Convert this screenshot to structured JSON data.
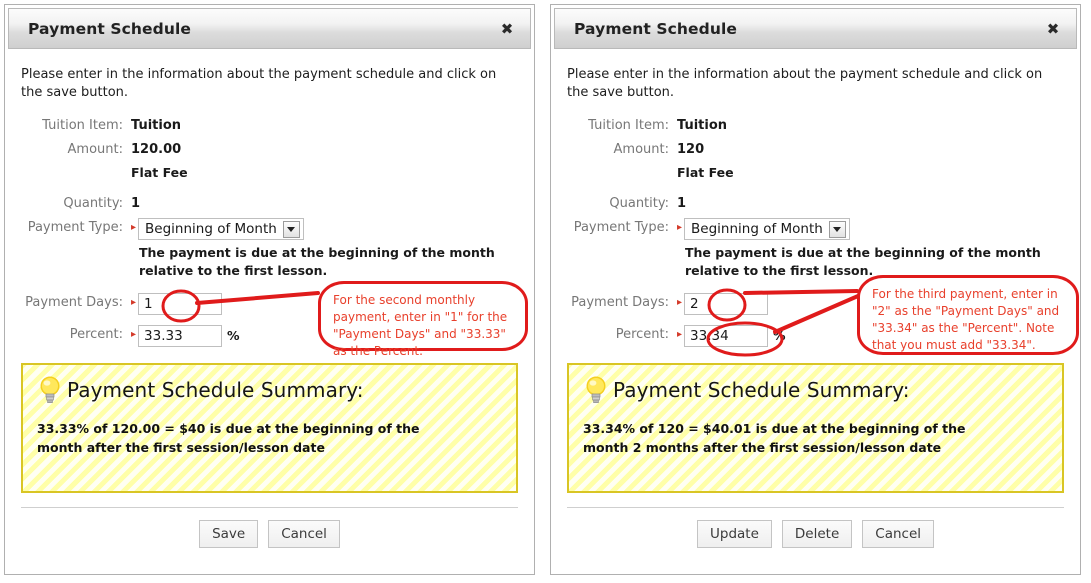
{
  "panels": [
    {
      "title": "Payment Schedule",
      "close_label": "✖",
      "intro": "Please enter in the information about the payment schedule and click on the save button.",
      "fields": {
        "tuition_item_label": "Tuition Item:",
        "tuition_item_value": "Tuition",
        "amount_label": "Amount:",
        "amount_value": "120.00",
        "amount_note": "Flat Fee",
        "quantity_label": "Quantity:",
        "quantity_value": "1",
        "payment_type_label": "Payment Type:",
        "payment_type_value": "Beginning of Month",
        "payment_type_help": "The payment is due at the beginning of the month relative to the first lesson.",
        "payment_days_label": "Payment Days:",
        "payment_days_value": "1",
        "percent_label": "Percent:",
        "percent_value": "33.33",
        "percent_sign": "%",
        "required_marker": "▸"
      },
      "summary": {
        "title": "Payment Schedule Summary:",
        "text": "33.33% of 120.00 = $40 is due at the beginning of the month after the first session/lesson date"
      },
      "buttons": [
        "Save",
        "Cancel"
      ],
      "annotation": "For the second monthly payment, enter in \"1\" for the \"Payment Days\" and \"33.33\" as the Percent."
    },
    {
      "title": "Payment Schedule",
      "close_label": "✖",
      "intro": "Please enter in the information about the payment schedule and click on the save button.",
      "fields": {
        "tuition_item_label": "Tuition Item:",
        "tuition_item_value": "Tuition",
        "amount_label": "Amount:",
        "amount_value": "120",
        "amount_note": "Flat Fee",
        "quantity_label": "Quantity:",
        "quantity_value": "1",
        "payment_type_label": "Payment Type:",
        "payment_type_value": "Beginning of Month",
        "payment_type_help": "The payment is due at the beginning of the month relative to the first lesson.",
        "payment_days_label": "Payment Days:",
        "payment_days_value": "2",
        "percent_label": "Percent:",
        "percent_value": "33.34",
        "percent_sign": "%",
        "required_marker": "▸"
      },
      "summary": {
        "title": "Payment Schedule Summary:",
        "text": "33.34% of 120 = $40.01 is due at the beginning of the month 2 months after the first session/lesson date"
      },
      "buttons": [
        "Update",
        "Delete",
        "Cancel"
      ],
      "annotation": "For the third payment, enter in \"2\" as the \"Payment Days\" and \"33.34\" as the \"Percent\".  Note that you must add \"33.34\"."
    }
  ],
  "colors": {
    "annotation_red": "#e01b1b",
    "annotation_text": "#e8402c",
    "summary_border": "#d9c524",
    "summary_bg": "#ffffa8",
    "required_marker": "#d43a2a"
  }
}
